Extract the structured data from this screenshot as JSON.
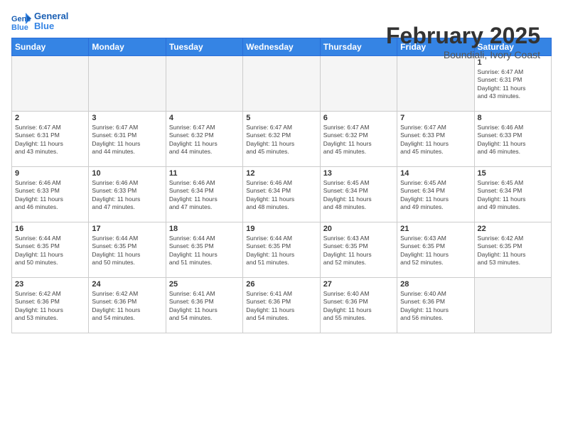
{
  "logo": {
    "line1": "General",
    "line2": "Blue"
  },
  "header": {
    "title": "February 2025",
    "subtitle": "Boundiali, Ivory Coast"
  },
  "weekdays": [
    "Sunday",
    "Monday",
    "Tuesday",
    "Wednesday",
    "Thursday",
    "Friday",
    "Saturday"
  ],
  "weeks": [
    [
      {
        "day": "",
        "info": ""
      },
      {
        "day": "",
        "info": ""
      },
      {
        "day": "",
        "info": ""
      },
      {
        "day": "",
        "info": ""
      },
      {
        "day": "",
        "info": ""
      },
      {
        "day": "",
        "info": ""
      },
      {
        "day": "1",
        "info": "Sunrise: 6:47 AM\nSunset: 6:31 PM\nDaylight: 11 hours\nand 43 minutes."
      }
    ],
    [
      {
        "day": "2",
        "info": "Sunrise: 6:47 AM\nSunset: 6:31 PM\nDaylight: 11 hours\nand 43 minutes."
      },
      {
        "day": "3",
        "info": "Sunrise: 6:47 AM\nSunset: 6:31 PM\nDaylight: 11 hours\nand 44 minutes."
      },
      {
        "day": "4",
        "info": "Sunrise: 6:47 AM\nSunset: 6:32 PM\nDaylight: 11 hours\nand 44 minutes."
      },
      {
        "day": "5",
        "info": "Sunrise: 6:47 AM\nSunset: 6:32 PM\nDaylight: 11 hours\nand 45 minutes."
      },
      {
        "day": "6",
        "info": "Sunrise: 6:47 AM\nSunset: 6:32 PM\nDaylight: 11 hours\nand 45 minutes."
      },
      {
        "day": "7",
        "info": "Sunrise: 6:47 AM\nSunset: 6:33 PM\nDaylight: 11 hours\nand 45 minutes."
      },
      {
        "day": "8",
        "info": "Sunrise: 6:46 AM\nSunset: 6:33 PM\nDaylight: 11 hours\nand 46 minutes."
      }
    ],
    [
      {
        "day": "9",
        "info": "Sunrise: 6:46 AM\nSunset: 6:33 PM\nDaylight: 11 hours\nand 46 minutes."
      },
      {
        "day": "10",
        "info": "Sunrise: 6:46 AM\nSunset: 6:33 PM\nDaylight: 11 hours\nand 47 minutes."
      },
      {
        "day": "11",
        "info": "Sunrise: 6:46 AM\nSunset: 6:34 PM\nDaylight: 11 hours\nand 47 minutes."
      },
      {
        "day": "12",
        "info": "Sunrise: 6:46 AM\nSunset: 6:34 PM\nDaylight: 11 hours\nand 48 minutes."
      },
      {
        "day": "13",
        "info": "Sunrise: 6:45 AM\nSunset: 6:34 PM\nDaylight: 11 hours\nand 48 minutes."
      },
      {
        "day": "14",
        "info": "Sunrise: 6:45 AM\nSunset: 6:34 PM\nDaylight: 11 hours\nand 49 minutes."
      },
      {
        "day": "15",
        "info": "Sunrise: 6:45 AM\nSunset: 6:34 PM\nDaylight: 11 hours\nand 49 minutes."
      }
    ],
    [
      {
        "day": "16",
        "info": "Sunrise: 6:44 AM\nSunset: 6:35 PM\nDaylight: 11 hours\nand 50 minutes."
      },
      {
        "day": "17",
        "info": "Sunrise: 6:44 AM\nSunset: 6:35 PM\nDaylight: 11 hours\nand 50 minutes."
      },
      {
        "day": "18",
        "info": "Sunrise: 6:44 AM\nSunset: 6:35 PM\nDaylight: 11 hours\nand 51 minutes."
      },
      {
        "day": "19",
        "info": "Sunrise: 6:44 AM\nSunset: 6:35 PM\nDaylight: 11 hours\nand 51 minutes."
      },
      {
        "day": "20",
        "info": "Sunrise: 6:43 AM\nSunset: 6:35 PM\nDaylight: 11 hours\nand 52 minutes."
      },
      {
        "day": "21",
        "info": "Sunrise: 6:43 AM\nSunset: 6:35 PM\nDaylight: 11 hours\nand 52 minutes."
      },
      {
        "day": "22",
        "info": "Sunrise: 6:42 AM\nSunset: 6:35 PM\nDaylight: 11 hours\nand 53 minutes."
      }
    ],
    [
      {
        "day": "23",
        "info": "Sunrise: 6:42 AM\nSunset: 6:36 PM\nDaylight: 11 hours\nand 53 minutes."
      },
      {
        "day": "24",
        "info": "Sunrise: 6:42 AM\nSunset: 6:36 PM\nDaylight: 11 hours\nand 54 minutes."
      },
      {
        "day": "25",
        "info": "Sunrise: 6:41 AM\nSunset: 6:36 PM\nDaylight: 11 hours\nand 54 minutes."
      },
      {
        "day": "26",
        "info": "Sunrise: 6:41 AM\nSunset: 6:36 PM\nDaylight: 11 hours\nand 54 minutes."
      },
      {
        "day": "27",
        "info": "Sunrise: 6:40 AM\nSunset: 6:36 PM\nDaylight: 11 hours\nand 55 minutes."
      },
      {
        "day": "28",
        "info": "Sunrise: 6:40 AM\nSunset: 6:36 PM\nDaylight: 11 hours\nand 56 minutes."
      },
      {
        "day": "",
        "info": ""
      }
    ]
  ]
}
